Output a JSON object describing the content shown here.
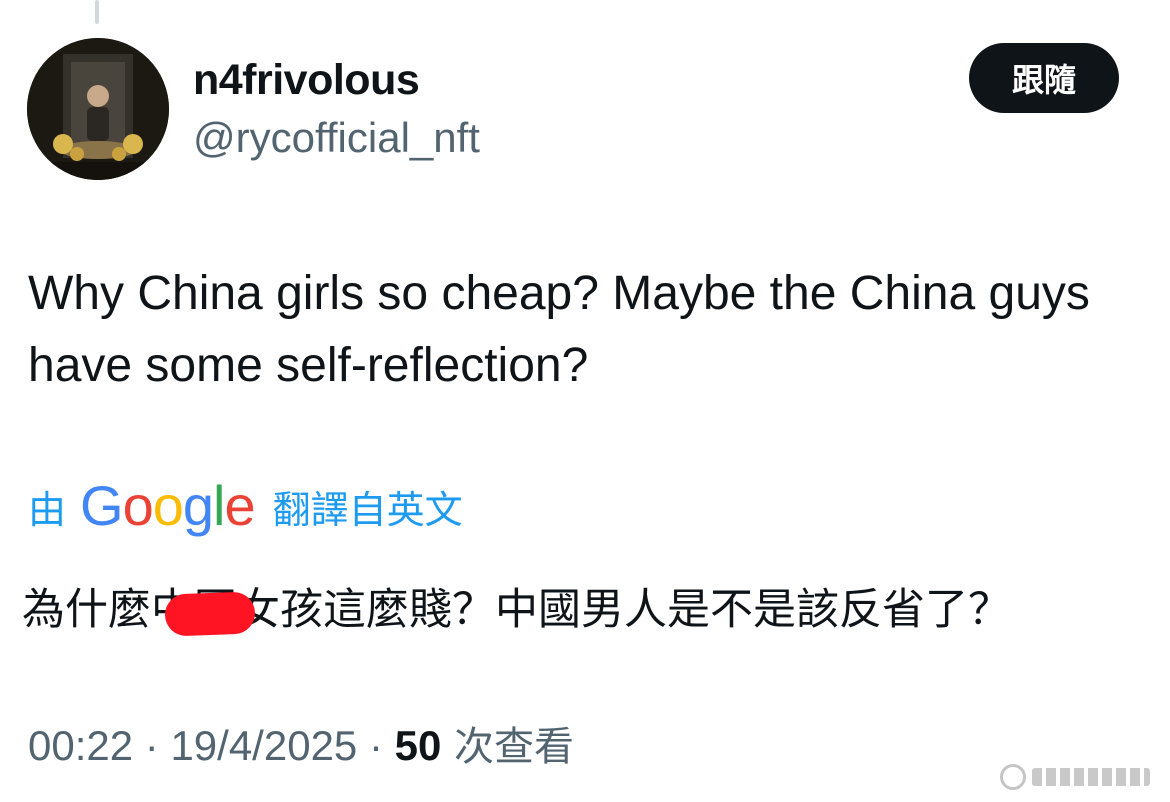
{
  "author": {
    "display_name": "n4frivolous",
    "handle": "@rycofficial_nft"
  },
  "follow_button": {
    "label": "跟隨"
  },
  "tweet": {
    "text": "Why China girls so cheap? Maybe the China guys have some self-reflection?"
  },
  "translation": {
    "prefix": "由",
    "provider_logo_letters": [
      "G",
      "o",
      "o",
      "g",
      "l",
      "e"
    ],
    "suffix": "翻譯自英文",
    "text": "為什麼中國女孩這麼賤？中國男人是不是該反省了？"
  },
  "meta": {
    "time": "00:22",
    "separator": " · ",
    "date": "19/4/2025",
    "views_count": "50",
    "views_label": " 次查看"
  },
  "colors": {
    "link_blue": "#1d9bf0",
    "text_primary": "#0f1419",
    "text_secondary": "#536471",
    "follow_button_bg": "#0f1419",
    "redaction_red": "#ff1424",
    "google_blue": "#4285f4",
    "google_red": "#ea4335",
    "google_yellow": "#fbbc05",
    "google_green": "#34a853"
  }
}
